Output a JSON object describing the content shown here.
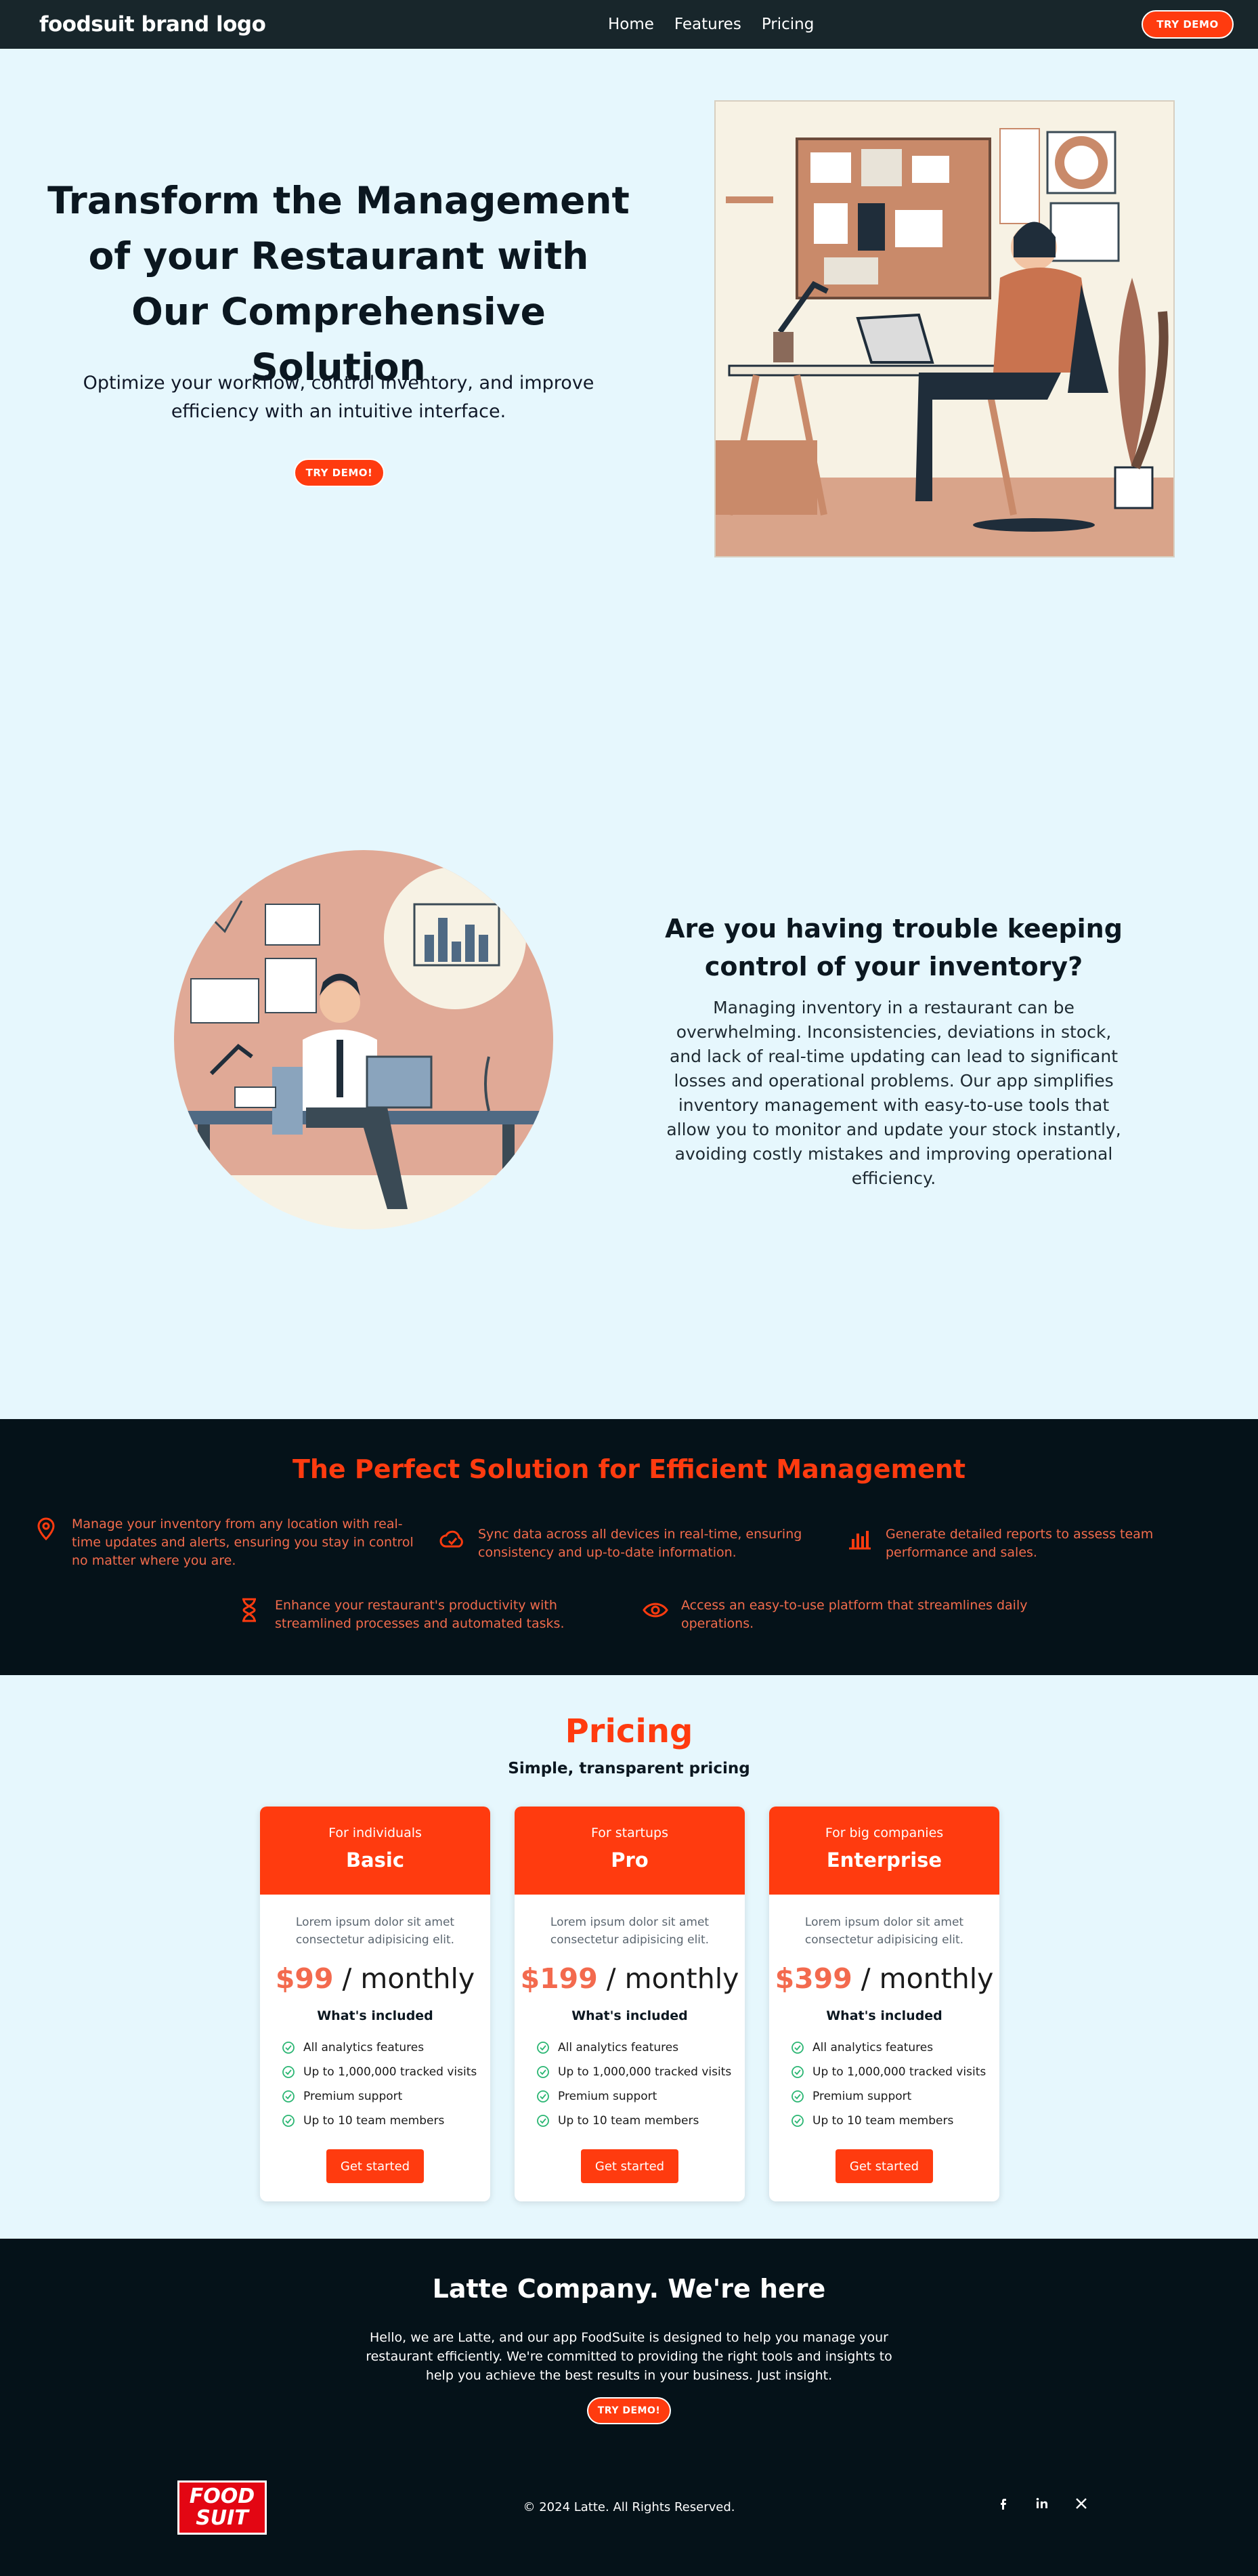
{
  "nav": {
    "brand": "foodsuit brand logo",
    "links": [
      "Home",
      "Features",
      "Pricing"
    ],
    "cta": "TRY DEMO"
  },
  "hero": {
    "title": "Transform the Management of your Restaurant with Our Comprehensive Solution",
    "subtitle": "Optimize your workflow, control inventory, and improve efficiency with an intuitive interface.",
    "cta": "TRY DEMO!"
  },
  "inventory": {
    "title": "Are you having trouble keeping control of your inventory?",
    "body": "Managing inventory in a restaurant can be overwhelming. Inconsistencies, deviations in stock, and lack of real-time updating can lead to significant losses and operational problems. Our app simplifies inventory management with easy-to-use tools that allow you to monitor and update your stock instantly, avoiding costly mistakes and improving operational efficiency."
  },
  "features": {
    "title": "The Perfect Solution for Efficient Management",
    "items": [
      {
        "icon": "location-pin-icon",
        "text": "Manage your inventory from any location with real-time updates and alerts, ensuring you stay in control no matter where you are."
      },
      {
        "icon": "cloud-check-icon",
        "text": "Sync data across all devices in real-time, ensuring consistency and up-to-date information."
      },
      {
        "icon": "bar-chart-icon",
        "text": "Generate detailed reports to assess team performance and sales."
      },
      {
        "icon": "hourglass-icon",
        "text": "Enhance your restaurant's productivity with streamlined processes and automated tasks."
      },
      {
        "icon": "eye-icon",
        "text": "Access an easy-to-use platform that streamlines daily operations."
      }
    ]
  },
  "pricing": {
    "title": "Pricing",
    "subtitle": "Simple, transparent pricing",
    "plans": [
      {
        "for": "For individuals",
        "name": "Basic",
        "desc": "Lorem ipsum dolor sit amet consectetur adipisicing elit.",
        "price": "$99",
        "period": "/ monthly",
        "included": "What's included",
        "features": [
          "All analytics features",
          "Up to 1,000,000 tracked visits",
          "Premium support",
          "Up to 10 team members"
        ],
        "cta": "Get started"
      },
      {
        "for": "For startups",
        "name": "Pro",
        "desc": "Lorem ipsum dolor sit amet consectetur adipisicing elit.",
        "price": "$199",
        "period": "/ monthly",
        "included": "What's included",
        "features": [
          "All analytics features",
          "Up to 1,000,000 tracked visits",
          "Premium support",
          "Up to 10 team members"
        ],
        "cta": "Get started"
      },
      {
        "for": "For big companies",
        "name": "Enterprise",
        "desc": "Lorem ipsum dolor sit amet consectetur adipisicing elit.",
        "price": "$399",
        "period": "/ monthly",
        "included": "What's included",
        "features": [
          "All analytics features",
          "Up to 1,000,000 tracked visits",
          "Premium support",
          "Up to 10 team members"
        ],
        "cta": "Get started"
      }
    ]
  },
  "footer": {
    "title": "Latte Company. We're here",
    "body": "Hello, we are Latte, and our app FoodSuite is designed to help you manage your restaurant efficiently. We're committed to providing the right tools and insights to help you achieve the best results in your business. Just insight.",
    "cta": "TRY DEMO!",
    "logo_line1": "FOOD",
    "logo_line2": "SUIT",
    "copyright": "© 2024 Latte. All Rights Reserved.",
    "social": [
      "facebook-icon",
      "linkedin-icon",
      "x-icon"
    ]
  },
  "colors": {
    "accent": "#ff3b0f",
    "dark": "#051219",
    "background": "#e6f7fd"
  }
}
